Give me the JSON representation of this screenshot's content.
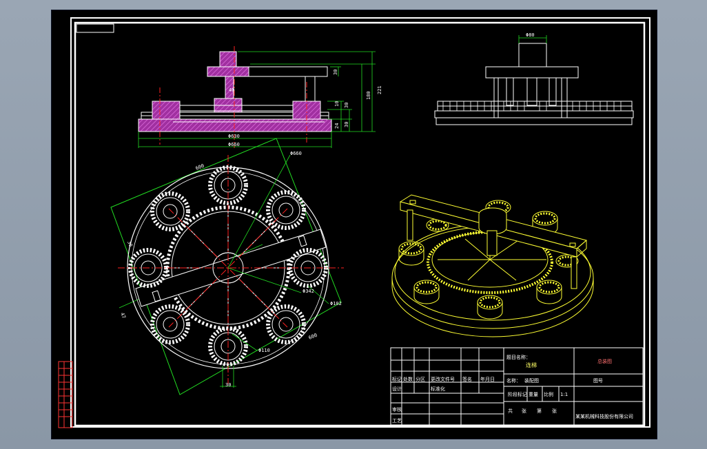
{
  "colors": {
    "background": "#000000",
    "lines": "#ffffff",
    "section_hatch": "#cc44cc",
    "center_lines": "#ff2020",
    "dimensions": "#22dd22",
    "isometric": "#ffff33"
  },
  "front_view": {
    "dims": {
      "d630": "Φ630",
      "d660": "Φ660",
      "h30_top": "30",
      "h40": "40",
      "h180": "180",
      "h221": "221",
      "h10": "10",
      "h30_a": "30",
      "h24": "24",
      "h30_b": "30"
    }
  },
  "side_view": {
    "dims": {
      "d80": "Φ80"
    }
  },
  "top_view": {
    "dims": {
      "d660": "Φ660",
      "w600_top": "600",
      "d342": "Φ342",
      "d102": "Φ102",
      "d110": "Φ110",
      "w600_bottom": "600",
      "w30_left": "30",
      "w47": "47",
      "w30_bottom": "30"
    }
  },
  "title_block": {
    "design_title_label": "题目名称：",
    "design_title": "连梯",
    "drawing_name": "总装图",
    "part_label": "名称：",
    "part_name": "装配图",
    "drawing_no_label": "图号",
    "scale": "1:1",
    "row_labels": [
      "标记",
      "处数",
      "分区",
      "更改文件号",
      "签名",
      "年月日"
    ],
    "designer": "设计",
    "standard": "标准化",
    "approve": "审核",
    "process": "工艺",
    "stage": "阶段标记",
    "weight": "重量",
    "ratio": "比例",
    "sheet_a": "共",
    "sheet_b": "张",
    "sheet_c": "第",
    "sheet_d": "张",
    "company": "某某机械科技股份有限公司"
  },
  "revision_table": {
    "rows": [
      "",
      "",
      "",
      "",
      "",
      "",
      "",
      "",
      "",
      ""
    ]
  }
}
